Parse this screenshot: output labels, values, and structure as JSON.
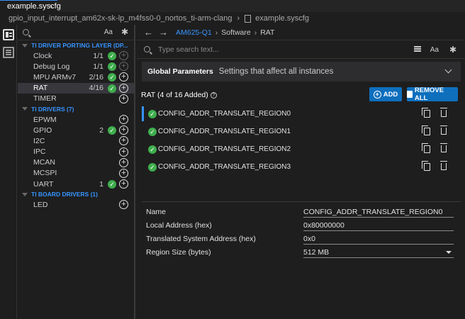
{
  "editor": {
    "tab_label": "example.syscfg",
    "breadcrumb": {
      "project": "gpio_input_interrupt_am62x-sk-lp_m4fss0-0_nortos_ti-arm-clang",
      "file": "example.syscfg"
    }
  },
  "sidebar": {
    "search_aa": "Aa",
    "groups": [
      {
        "label": "TI DRIVER PORTING LAYER (DP...",
        "items": [
          {
            "label": "Clock",
            "count": "1/1",
            "checked": true,
            "addable": false
          },
          {
            "label": "Debug Log",
            "count": "1/1",
            "checked": true,
            "addable": false
          },
          {
            "label": "MPU ARMv7",
            "count": "2/16",
            "checked": true,
            "addable": true
          },
          {
            "label": "RAT",
            "count": "4/16",
            "checked": true,
            "addable": true,
            "selected": true
          },
          {
            "label": "TIMER",
            "count": "",
            "checked": false,
            "addable": true
          }
        ]
      },
      {
        "label": "TI DRIVERS (7)",
        "items": [
          {
            "label": "EPWM",
            "count": "",
            "checked": false,
            "addable": true
          },
          {
            "label": "GPIO",
            "count": "2",
            "checked": true,
            "addable": true
          },
          {
            "label": "I2C",
            "count": "",
            "checked": false,
            "addable": true
          },
          {
            "label": "IPC",
            "count": "",
            "checked": false,
            "addable": true
          },
          {
            "label": "MCAN",
            "count": "",
            "checked": false,
            "addable": true
          },
          {
            "label": "MCSPI",
            "count": "",
            "checked": false,
            "addable": true
          },
          {
            "label": "UART",
            "count": "1",
            "checked": true,
            "addable": true
          }
        ]
      },
      {
        "label": "TI BOARD DRIVERS (1)",
        "items": [
          {
            "label": "LED",
            "count": "",
            "checked": false,
            "addable": true
          }
        ]
      }
    ]
  },
  "main": {
    "nav": {
      "device": "AM625-Q1",
      "crumbs": [
        "Software",
        "RAT"
      ]
    },
    "search": {
      "placeholder": "Type search text...",
      "aa": "Aa"
    },
    "global_params": {
      "title": "Global Parameters",
      "desc": "Settings that affect all instances"
    },
    "rat": {
      "heading": "RAT (4 of 16 Added)",
      "add_label": "ADD",
      "remove_all_label": "REMOVE ALL",
      "regions": [
        "CONFIG_ADDR_TRANSLATE_REGION0",
        "CONFIG_ADDR_TRANSLATE_REGION1",
        "CONFIG_ADDR_TRANSLATE_REGION2",
        "CONFIG_ADDR_TRANSLATE_REGION3"
      ]
    },
    "properties": [
      {
        "label": "Name",
        "value": "CONFIG_ADDR_TRANSLATE_REGION0"
      },
      {
        "label": "Local Address (hex)",
        "value": "0x80000000"
      },
      {
        "label": "Translated System Address (hex)",
        "value": "0x0"
      },
      {
        "label": "Region Size (bytes)",
        "value": "512 MB",
        "dropdown": true
      }
    ]
  },
  "colors": {
    "accent": "#3794ff",
    "check": "#3fae4d",
    "button": "#0e6fbd"
  }
}
